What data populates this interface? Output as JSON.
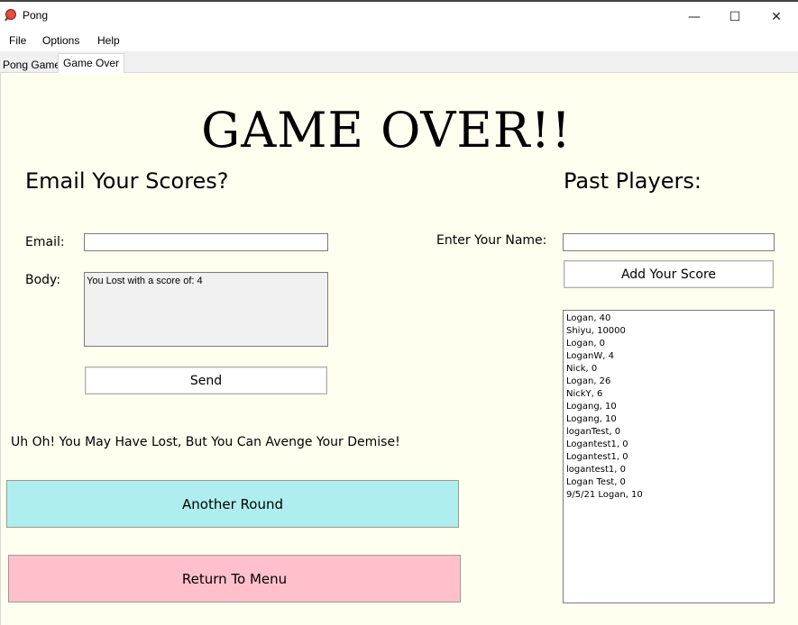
{
  "window": {
    "title": "Pong",
    "minimize_glyph": "—",
    "maximize_glyph": "☐",
    "close_glyph": "✕"
  },
  "menu": [
    "File",
    "Options",
    "Help"
  ],
  "tabs": [
    {
      "label": "Pong Game",
      "active": false
    },
    {
      "label": "Game Over",
      "active": true
    }
  ],
  "game_over": {
    "title": "GAME OVER!!",
    "email_heading": "Email Your Scores?",
    "email_label": "Email:",
    "email_value": "",
    "body_label": "Body:",
    "body_value": "You Lost with a score of: 4",
    "send_label": "Send",
    "message": "Uh Oh! You May Have Lost, But You Can Avenge Your Demise!",
    "another_round_label": "Another Round",
    "return_label": "Return To Menu",
    "past_players_heading": "Past Players:",
    "name_label": "Enter Your Name:",
    "name_value": "",
    "add_score_label": "Add Your Score",
    "scores": [
      "Logan, 40",
      "Shiyu, 10000",
      "Logan, 0",
      "LoganW, 4",
      "Nick, 0",
      "Logan, 26",
      "NickY, 6",
      "Logang, 10",
      "Logang, 10",
      "loganTest, 0",
      "Logantest1, 0",
      "Logantest1, 0",
      "logantest1, 0",
      "Logan Test, 0",
      "9/5/21 Logan, 10"
    ]
  },
  "colors": {
    "background": "#fffff0",
    "another_round": "#afeeee",
    "return_to_menu": "#ffc0cb"
  }
}
